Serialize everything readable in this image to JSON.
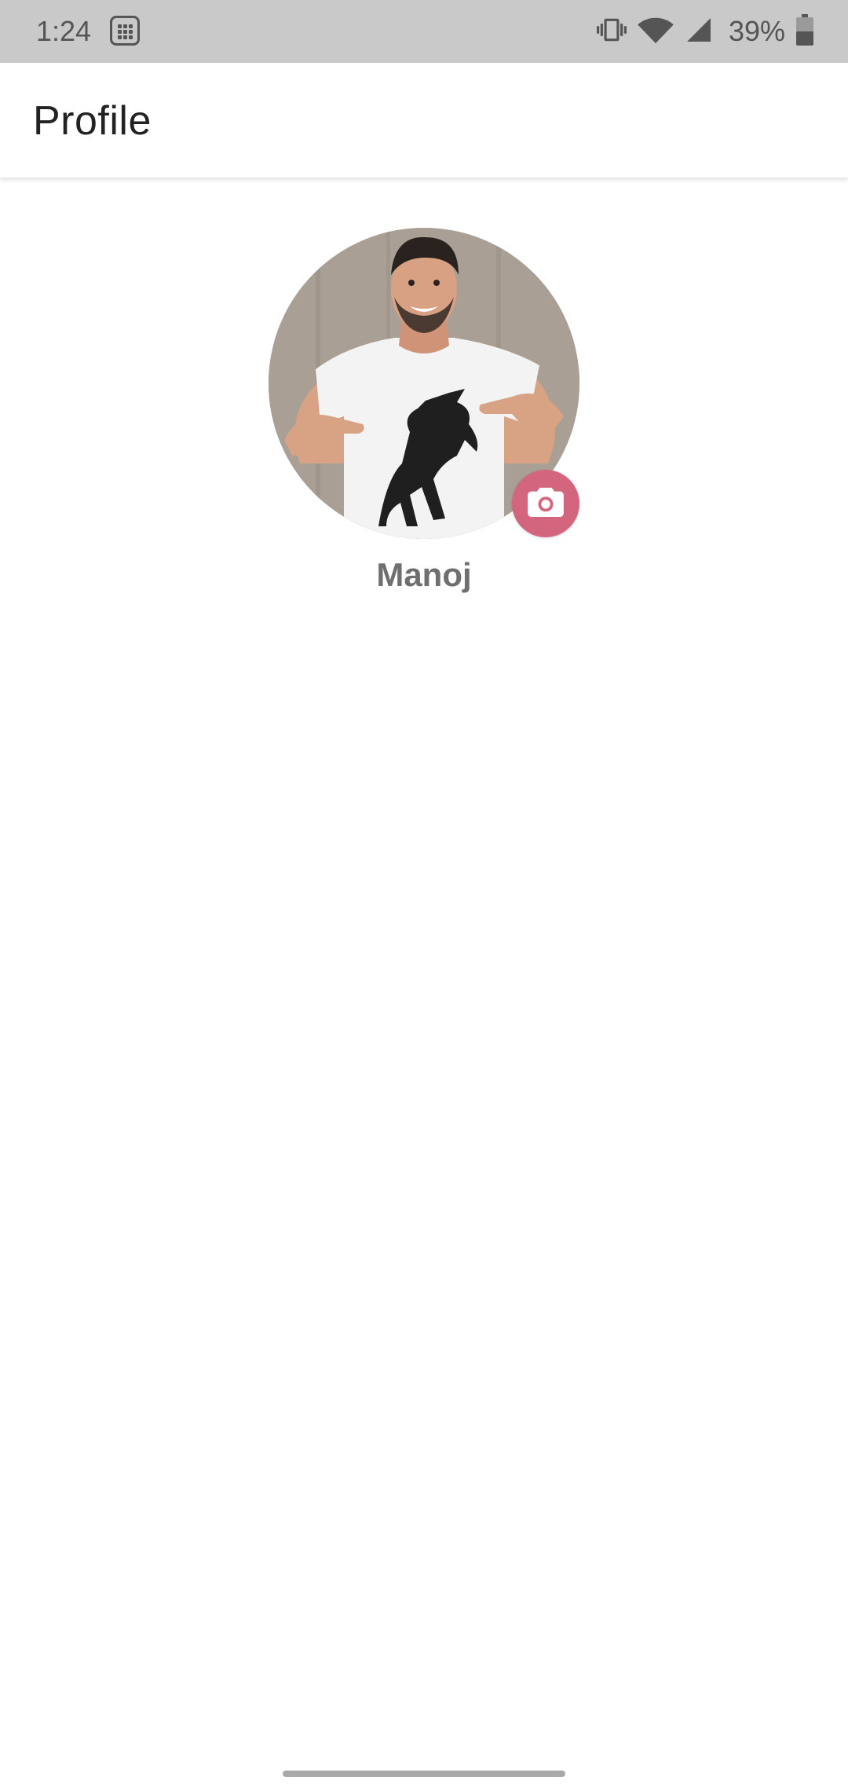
{
  "status_bar": {
    "time": "1:24",
    "battery_percent": "39%",
    "icons": [
      "calculator-notification-icon",
      "vibrate-icon",
      "wifi-icon",
      "cellular-signal-icon",
      "battery-icon"
    ]
  },
  "app_bar": {
    "title": "Profile"
  },
  "profile": {
    "name": "Manoj",
    "avatar_icon": "profile-photo",
    "camera_icon": "camera-icon",
    "accent_color": "#d3667e"
  },
  "navigation": {
    "home_indicator": "home-indicator"
  }
}
